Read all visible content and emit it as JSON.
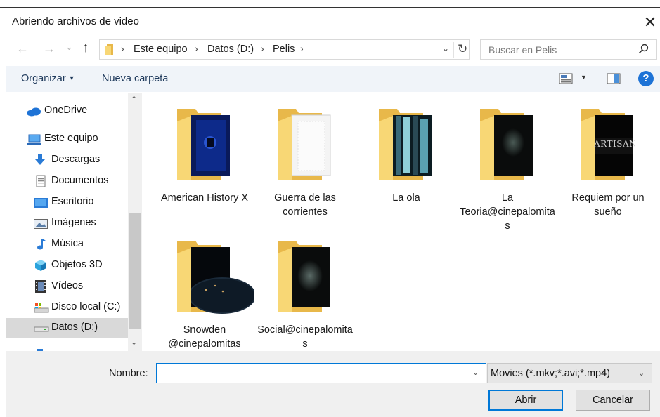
{
  "window": {
    "title": "Abriendo archivos de video",
    "close_glyph": "✕"
  },
  "address": {
    "back_glyph": "←",
    "forward_glyph": "→",
    "recent_glyph": "⌄",
    "up_glyph": "↑",
    "crumbs": [
      "Este equipo",
      "Datos (D:)",
      "Pelis"
    ],
    "separator": "›",
    "dropdown_glyph": "⌄",
    "refresh_glyph": "↻"
  },
  "search": {
    "placeholder": "Buscar en Pelis"
  },
  "toolbar": {
    "organize_label": "Organizar",
    "organize_caret": "▼",
    "new_folder_label": "Nueva carpeta",
    "view_caret": "▼",
    "help_glyph": "?"
  },
  "nav": {
    "items": [
      {
        "label": "OneDrive",
        "icon": "onedrive-icon",
        "selected": false
      },
      {
        "label": "Este equipo",
        "icon": "this-pc-icon",
        "selected": false
      },
      {
        "label": "Descargas",
        "icon": "downloads-icon",
        "selected": false
      },
      {
        "label": "Documentos",
        "icon": "documents-icon",
        "selected": false
      },
      {
        "label": "Escritorio",
        "icon": "desktop-icon",
        "selected": false
      },
      {
        "label": "Imágenes",
        "icon": "pictures-icon",
        "selected": false
      },
      {
        "label": "Música",
        "icon": "music-icon",
        "selected": false
      },
      {
        "label": "Objetos 3D",
        "icon": "objects-3d-icon",
        "selected": false
      },
      {
        "label": "Vídeos",
        "icon": "videos-icon",
        "selected": false
      },
      {
        "label": "Disco local (C:)",
        "icon": "local-disk-icon",
        "selected": false
      },
      {
        "label": "Datos (D:)",
        "icon": "data-drive-icon",
        "selected": true
      }
    ],
    "scroll_up_glyph": "⌃",
    "scroll_down_glyph": "⌄"
  },
  "folders": [
    {
      "name": "American History X",
      "thumb": "blue-circuit"
    },
    {
      "name": "Guerra de las corrientes",
      "thumb": "white-document"
    },
    {
      "name": "La ola",
      "thumb": "teal-stripes"
    },
    {
      "name": "La Teoria@cinepalomitas",
      "thumb": "dark-glow"
    },
    {
      "name": "Requiem por un sueño",
      "thumb": "artisan-black",
      "thumb_text": "ARTISAN"
    },
    {
      "name": "Snowden @cinepalomitas",
      "thumb": "earth-night"
    },
    {
      "name": "Social@cinepalomitas",
      "thumb": "dark-glow"
    }
  ],
  "footer": {
    "name_label": "Nombre:",
    "name_value": "",
    "name_dropdown_glyph": "⌄",
    "filter_value": "Movies (*.mkv;*.avi;*.mp4)",
    "filter_dropdown_glyph": "⌄",
    "open_label": "Abrir",
    "cancel_label": "Cancelar"
  },
  "colors": {
    "accent": "#0078d7",
    "folder": "#f8d775",
    "folder_back": "#e8b84a",
    "toolbar_bg": "#f0f4f9",
    "footer_bg": "#f0f0f0",
    "selected_bg": "#d9d9d9"
  }
}
